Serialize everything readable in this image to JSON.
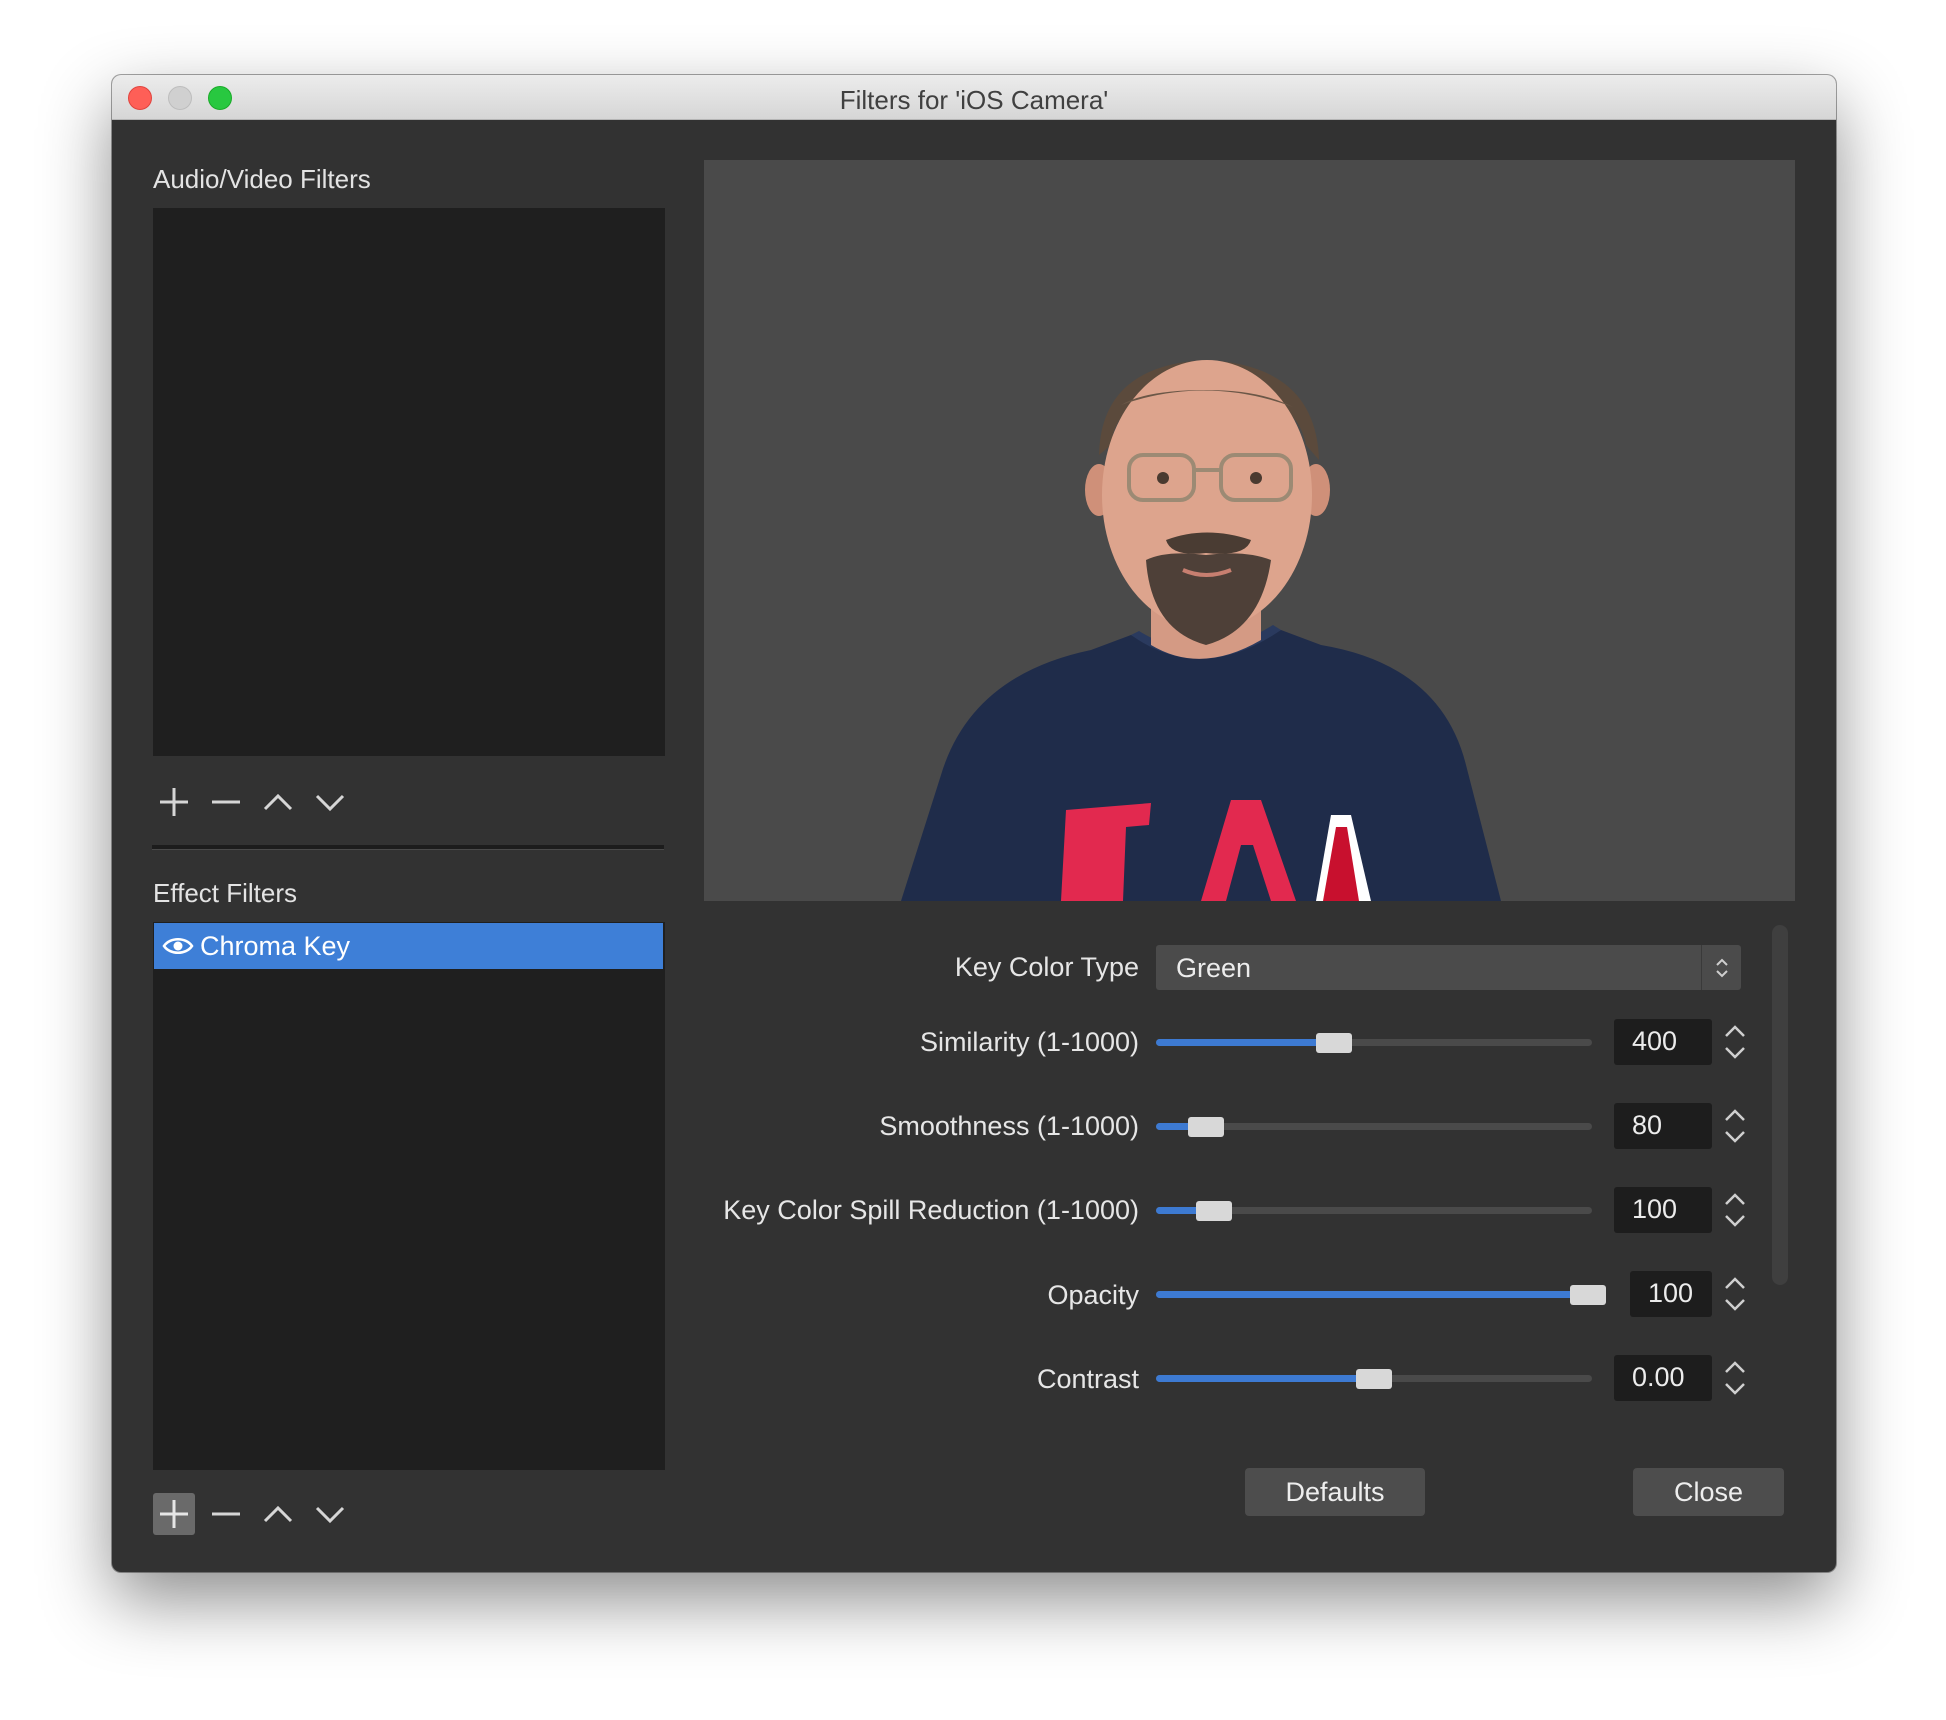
{
  "window": {
    "title": "Filters for 'iOS Camera'"
  },
  "audio_video_filters": {
    "label": "Audio/Video Filters",
    "items": []
  },
  "effect_filters": {
    "label": "Effect Filters",
    "items": [
      {
        "name": "Chroma Key",
        "visible": true,
        "selected": true
      }
    ]
  },
  "properties": {
    "key_color_type": {
      "label": "Key Color Type",
      "value": "Green"
    },
    "similarity": {
      "label": "Similarity (1-1000)",
      "value": "400",
      "fraction": 0.4
    },
    "smoothness": {
      "label": "Smoothness (1-1000)",
      "value": "80",
      "fraction": 0.08
    },
    "spill_reduction": {
      "label": "Key Color Spill Reduction (1-1000)",
      "value": "100",
      "fraction": 0.1
    },
    "opacity": {
      "label": "Opacity",
      "value": "100",
      "fraction": 1.0
    },
    "contrast": {
      "label": "Contrast",
      "value": "0.00",
      "fraction": 0.5
    }
  },
  "buttons": {
    "defaults": "Defaults",
    "close": "Close"
  },
  "colors": {
    "accent": "#3e7fd7",
    "background": "#323232",
    "list_background": "#1f1f1f",
    "preview_background": "#4a4a4a"
  }
}
